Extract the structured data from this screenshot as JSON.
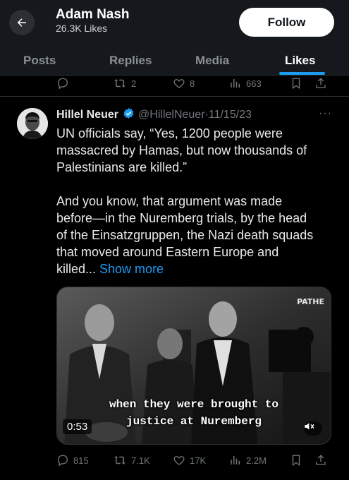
{
  "header": {
    "profile_name": "Adam Nash",
    "profile_likes": "26.3K Likes",
    "follow_label": "Follow",
    "back_icon": "arrow-left-icon"
  },
  "tabs": [
    {
      "label": "Posts"
    },
    {
      "label": "Replies"
    },
    {
      "label": "Media"
    },
    {
      "label": "Likes",
      "active": true
    }
  ],
  "previous_post": {
    "reposts": "2",
    "likes": "8",
    "views": "663"
  },
  "tweet": {
    "author_name": "Hillel Neuer",
    "handle": "@HillelNeuer",
    "separator": "·",
    "date": "11/15/23",
    "more": "···",
    "lines_p1": [
      "UN officials say, “Yes, 1200 people were",
      "massacred by Hamas, but now thousands of",
      "Palestinians are killed.”"
    ],
    "lines_p2": [
      "And you know, that argument was made",
      "before—in the Nuremberg trials, by the head",
      "of the Einsatzgruppen, the Nazi death squads",
      "that moved around Eastern Europe and"
    ],
    "last_line_start": "killed... ",
    "show_more": "Show more",
    "video": {
      "caption_line1": "when they were brought to",
      "caption_line2": "justice at Nuremberg",
      "duration": "0:53",
      "watermark": "PATHE"
    },
    "stats": {
      "replies": "815",
      "reposts": "7.1K",
      "likes": "17K",
      "views": "2.2M"
    }
  },
  "colors": {
    "accent": "#1d9bf0",
    "background": "#000000",
    "header_bg": "#15181c",
    "muted_text": "#71767b"
  }
}
